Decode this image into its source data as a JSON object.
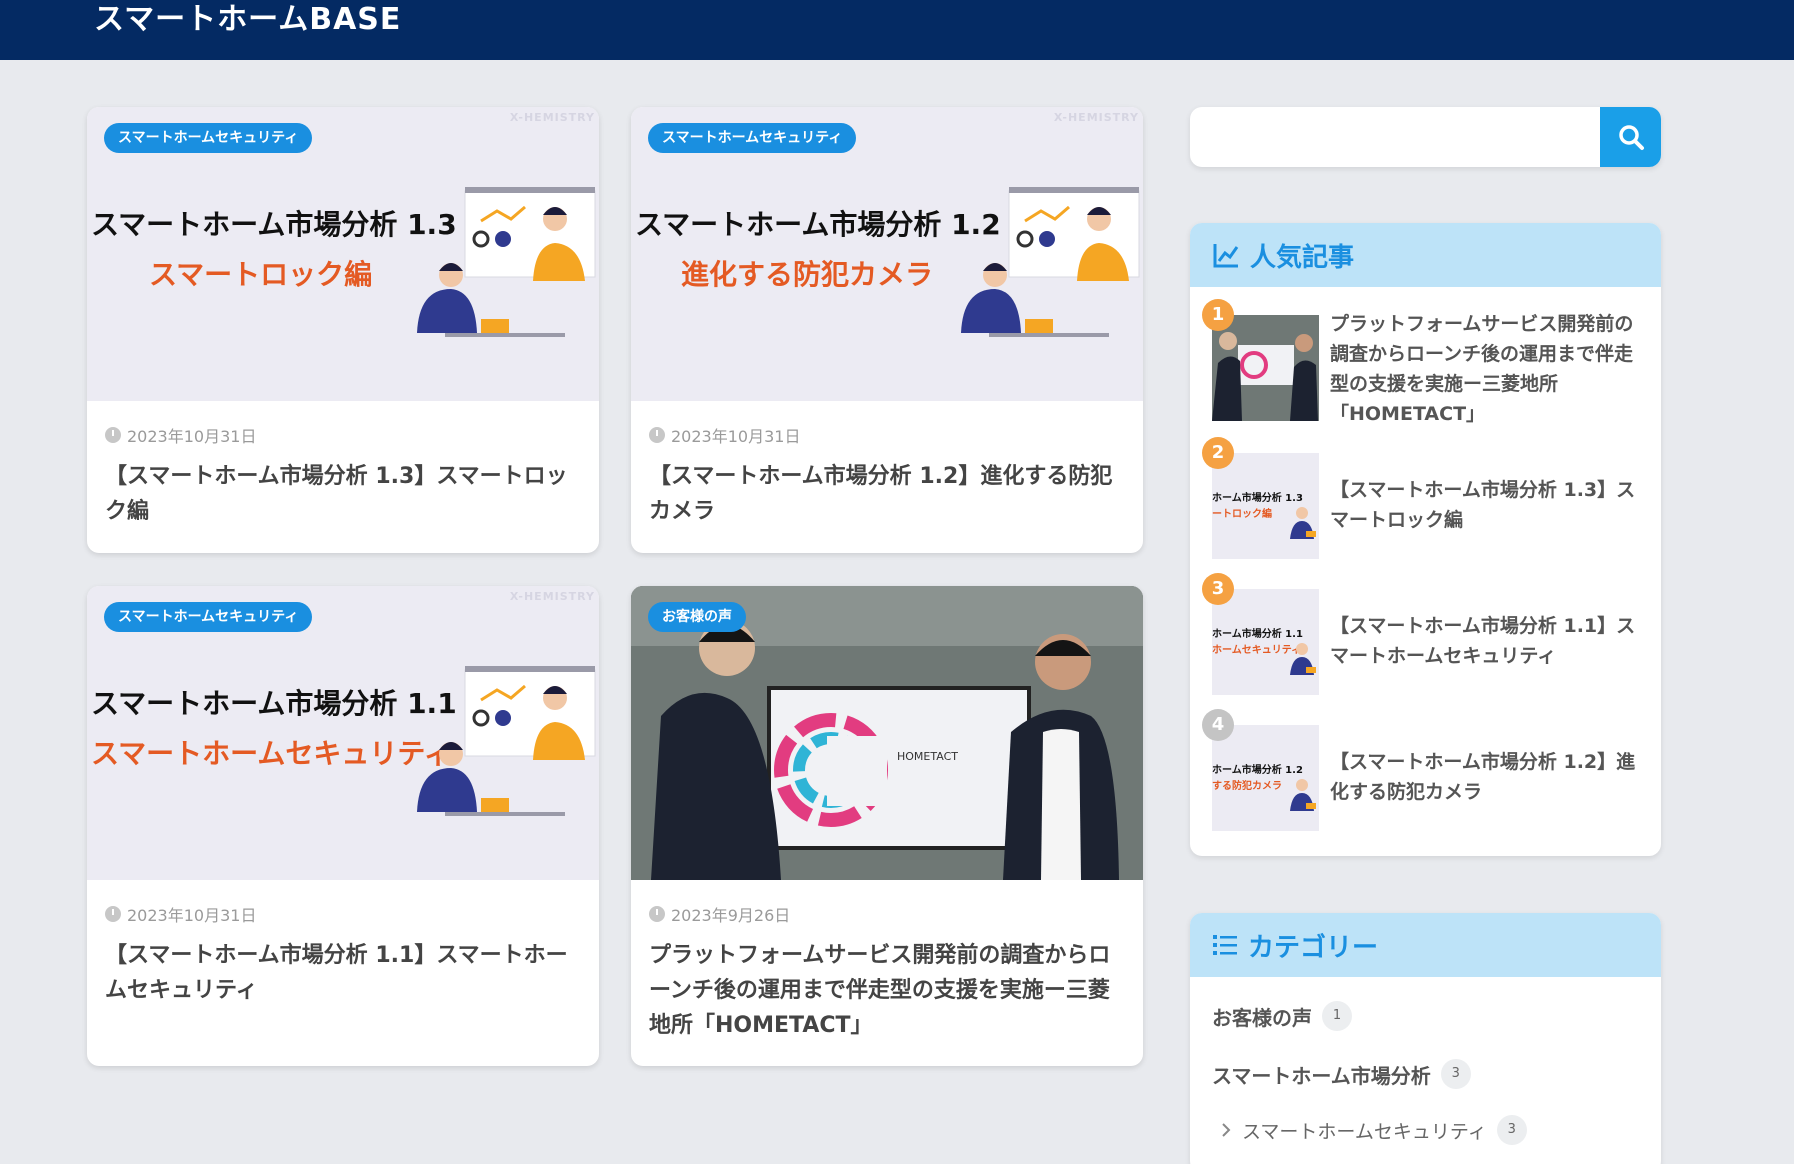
{
  "site": {
    "title": "スマートホームBASE"
  },
  "posts": [
    {
      "category": "スマートホームセキュリティ",
      "watermark": "X-HEMISTRY",
      "thumb_line1": "スマートホーム市場分析 1.3",
      "thumb_line2": "スマートロック編",
      "date": "2023年10月31日",
      "title": "【スマートホーム市場分析 1.3】スマートロック編"
    },
    {
      "category": "スマートホームセキュリティ",
      "watermark": "X-HEMISTRY",
      "thumb_line1": "スマートホーム市場分析 1.2",
      "thumb_line2": "進化する防犯カメラ",
      "date": "2023年10月31日",
      "title": "【スマートホーム市場分析 1.2】進化する防犯カメラ"
    },
    {
      "category": "スマートホームセキュリティ",
      "watermark": "X-HEMISTRY",
      "thumb_line1": "スマートホーム市場分析 1.1",
      "thumb_line2": "スマートホームセキュリティ",
      "date": "2023年10月31日",
      "title": "【スマートホーム市場分析 1.1】スマートホームセキュリティ"
    },
    {
      "category": "お客様の声",
      "photo_text": "HOMETACT",
      "date": "2023年9月26日",
      "title": "プラットフォームサービス開発前の調査からローンチ後の運用まで伴走型の支援を実施ー三菱地所「HOMETACT」"
    }
  ],
  "search": {
    "placeholder": "",
    "value": "",
    "icon": "search-icon"
  },
  "popular": {
    "heading": "人気記事",
    "icon": "chart-line-icon",
    "items": [
      {
        "rank": "1",
        "rank_color": "#f5a142",
        "title": "プラットフォームサービス開発前の調査からローンチ後の運用まで伴走型の支援を実施ー三菱地所「HOMETACT」"
      },
      {
        "rank": "2",
        "rank_color": "#f5a142",
        "thumb_line1": "ホーム市場分析 1.3",
        "thumb_line2": "ートロック編",
        "title": "【スマートホーム市場分析 1.3】スマートロック編"
      },
      {
        "rank": "3",
        "rank_color": "#f5a142",
        "thumb_line1": "ホーム市場分析 1.1",
        "thumb_line2": "ホームセキュリティ",
        "title": "【スマートホーム市場分析 1.1】スマートホームセキュリティ"
      },
      {
        "rank": "4",
        "rank_color": "#c4c4c4",
        "thumb_line1": "ホーム市場分析 1.2",
        "thumb_line2": "する防犯カメラ",
        "title": "【スマートホーム市場分析 1.2】進化する防犯カメラ"
      }
    ]
  },
  "categories": {
    "heading": "カテゴリー",
    "icon": "list-icon",
    "items": [
      {
        "label": "お客様の声",
        "count": "1"
      },
      {
        "label": "スマートホーム市場分析",
        "count": "3"
      },
      {
        "label": "スマートホームセキュリティ",
        "count": "3",
        "sub": true
      }
    ]
  },
  "colors": {
    "header": "#042a63",
    "accent": "#1a8fe0",
    "widget_head": "#bde3f8"
  }
}
